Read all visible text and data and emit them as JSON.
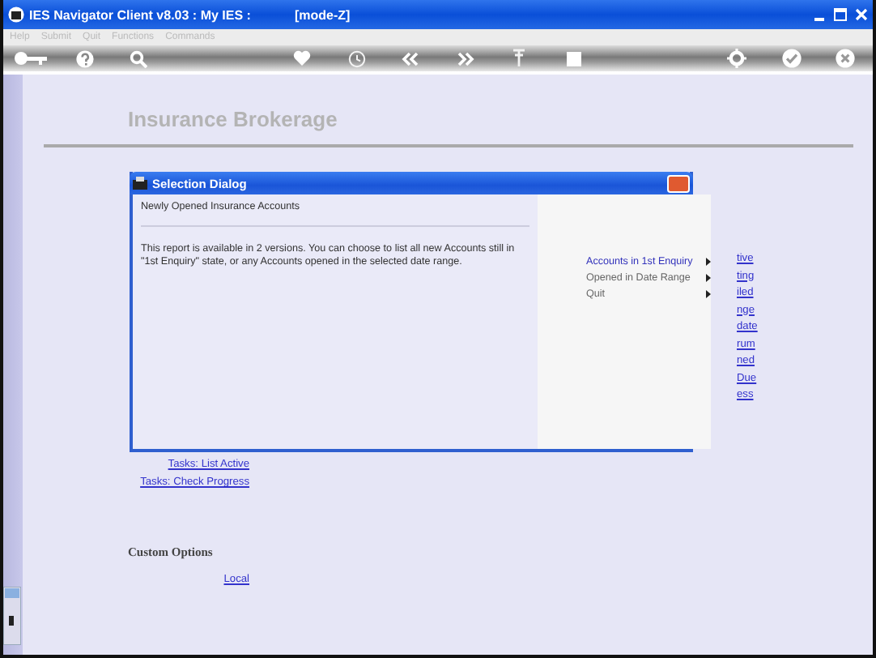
{
  "window": {
    "title": "IES Navigator Client v8.03 : My IES :",
    "mode": "[mode-Z]"
  },
  "menu": [
    "Help",
    "Submit",
    "Quit",
    "Functions",
    "Commands"
  ],
  "toolbar": [
    {
      "kind": "key"
    },
    {
      "kind": "help"
    },
    {
      "kind": "search"
    },
    {
      "kind": "heart"
    },
    {
      "kind": "clock"
    },
    {
      "kind": "back"
    },
    {
      "kind": "forward"
    },
    {
      "kind": "pin"
    },
    {
      "kind": "square"
    },
    {
      "kind": "gear"
    },
    {
      "kind": "check"
    },
    {
      "kind": "close"
    }
  ],
  "page": {
    "heading": "Insurance Brokerage",
    "side_links": [
      "tive",
      "ting",
      "iled",
      "nge",
      "date",
      "rum",
      "ned",
      "Due",
      "ess"
    ],
    "task_links": [
      "Tasks: List Active",
      "Tasks: Check Progress"
    ],
    "custom_heading": "Custom Options",
    "custom_links": [
      "Local"
    ]
  },
  "dialog": {
    "title": "Selection Dialog",
    "subtitle": "Newly Opened Insurance Accounts",
    "description": "This report is available in 2 versions. You can choose to list all new Accounts still in \"1st Enquiry\" state, or any Accounts opened in the selected date range.",
    "options": [
      {
        "label": "Accounts in 1st Enquiry",
        "selected": true
      },
      {
        "label": "Opened in Date Range",
        "selected": false
      },
      {
        "label": "Quit",
        "selected": false
      }
    ]
  }
}
